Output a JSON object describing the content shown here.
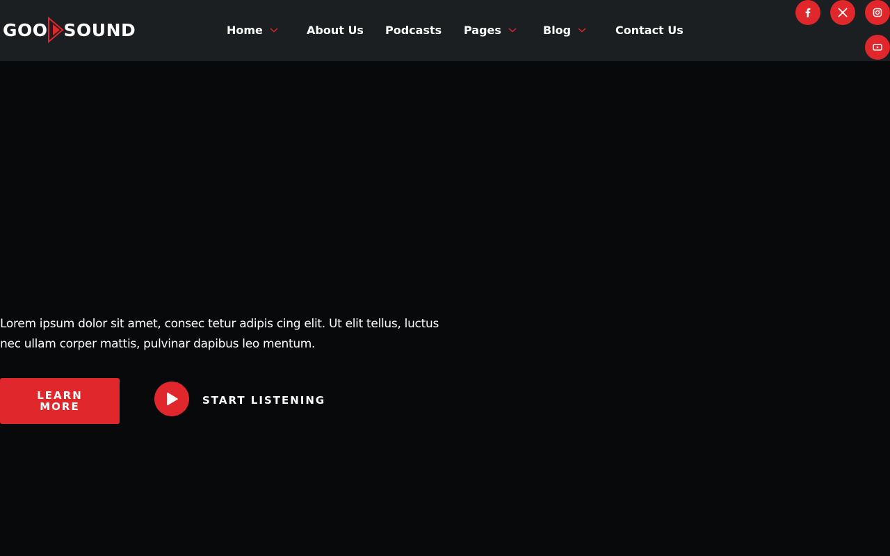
{
  "brand": {
    "logo_left": "GOO",
    "logo_right": "SOUND",
    "accent_color": "#e0282c"
  },
  "nav": {
    "items": [
      {
        "label": "Home",
        "has_dropdown": true
      },
      {
        "label": "About Us",
        "has_dropdown": false
      },
      {
        "label": "Podcasts",
        "has_dropdown": false
      },
      {
        "label": "Pages",
        "has_dropdown": true
      },
      {
        "label": "Blog",
        "has_dropdown": true
      },
      {
        "label": "Contact Us",
        "has_dropdown": false
      }
    ]
  },
  "social": {
    "icons": [
      "facebook-icon",
      "x-icon",
      "instagram-icon",
      "youtube-icon"
    ]
  },
  "hero": {
    "description": "Lorem ipsum dolor sit amet, consec tetur adipis cing elit. Ut elit tellus, luctus nec ullam corper mattis, pulvinar dapibus leo mentum.",
    "learn_more_label": "LEARN MORE",
    "start_listening_label": "START LISTENING"
  }
}
